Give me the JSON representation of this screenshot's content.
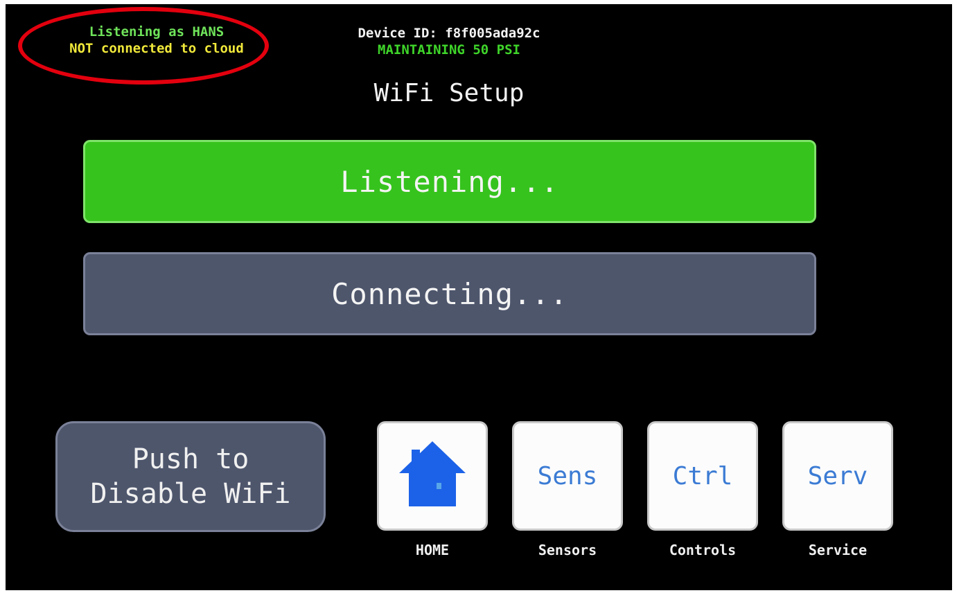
{
  "status": {
    "listening_line": "Listening as HANS",
    "cloud_line": "NOT connected to cloud",
    "listening_color": "#6fe35a",
    "cloud_color": "#f0e83a",
    "highlight_color": "#e3000e"
  },
  "device": {
    "id_line": "Device ID: f8f005ada92c",
    "mode_line": "MAINTAINING 50 PSI",
    "mode_color": "#3fd52a"
  },
  "title": "WiFi Setup",
  "steps": {
    "listening_label": "Listening...",
    "connecting_label": "Connecting...",
    "active_color": "#36c31d",
    "inactive_color": "#4e566c"
  },
  "disable_wifi": {
    "line1": "Push to",
    "line2": "Disable WiFi"
  },
  "nav": [
    {
      "icon": "home-icon",
      "text": "",
      "label": "HOME"
    },
    {
      "icon": "",
      "text": "Sens",
      "label": "Sensors"
    },
    {
      "icon": "",
      "text": "Ctrl",
      "label": "Controls"
    },
    {
      "icon": "",
      "text": "Serv",
      "label": "Service"
    }
  ]
}
